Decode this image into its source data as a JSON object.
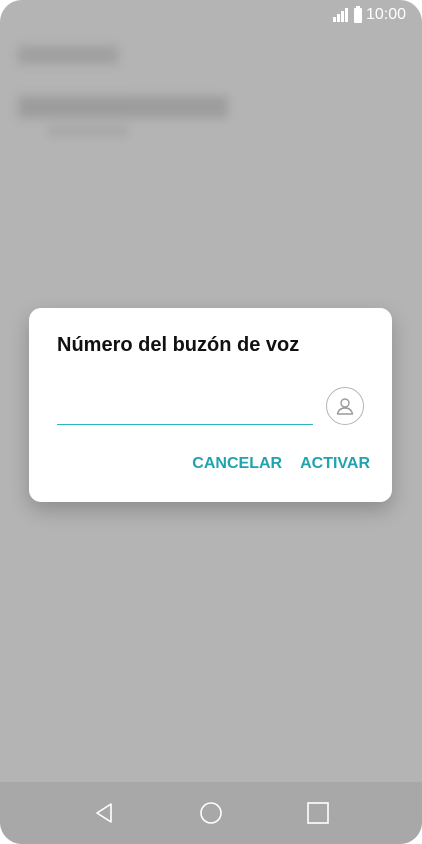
{
  "status_bar": {
    "time": "10:00",
    "icons": [
      "signal-icon",
      "battery-icon"
    ]
  },
  "dialog": {
    "title": "Número del buzón de voz",
    "input": {
      "value": "",
      "placeholder": ""
    },
    "contact_icon": "contact-person-icon",
    "cancel_label": "CANCELAR",
    "activate_label": "ACTIVAR"
  },
  "nav_bar": {
    "icons": [
      "back-icon",
      "home-icon",
      "recents-icon"
    ]
  },
  "colors": {
    "accent": "#1fa3b0",
    "underline": "#2fb3bf",
    "scrim": "#b4b4b4",
    "dialog_bg": "#ffffff"
  }
}
